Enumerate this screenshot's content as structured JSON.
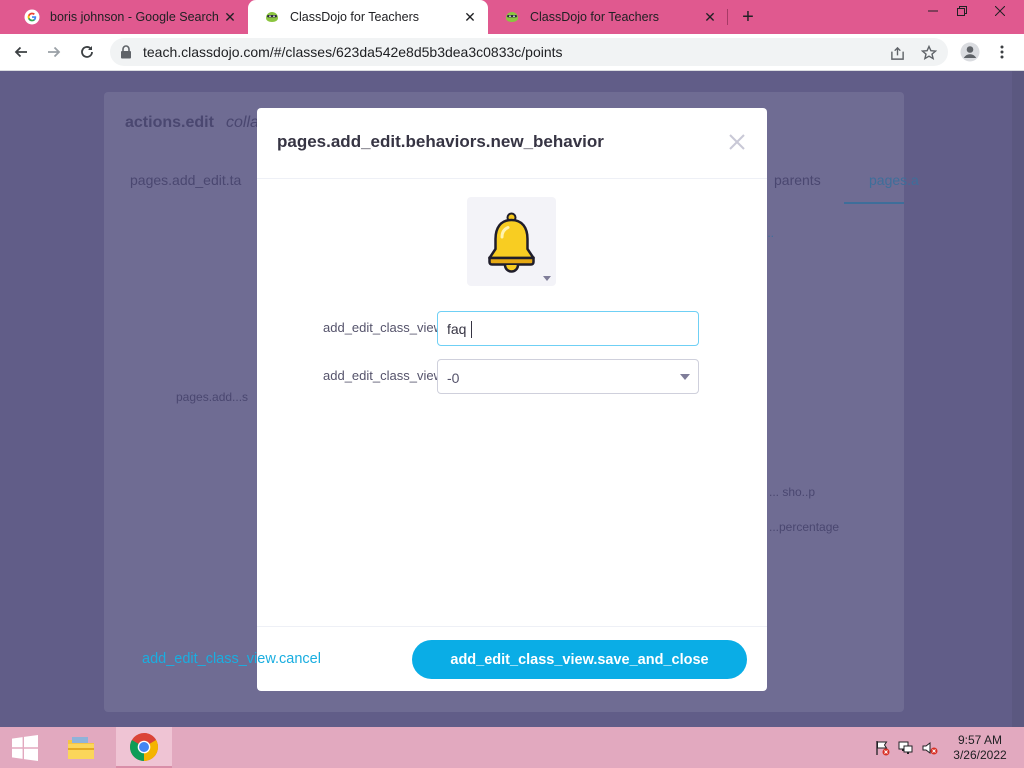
{
  "browser": {
    "tabs": [
      {
        "title": "boris johnson - Google Search",
        "favicon": "google-g-icon",
        "active": false
      },
      {
        "title": "ClassDojo for Teachers",
        "favicon": "classdojo-icon",
        "active": true
      },
      {
        "title": "ClassDojo for Teachers",
        "favicon": "classdojo-icon",
        "active": false
      }
    ],
    "url": "teach.classdojo.com/#/classes/623da542e8d5b3dea3c0833c/points"
  },
  "background": {
    "heading": "actions.edit",
    "heading_suffix": "colla",
    "tab_left": "pages.add_edit.ta",
    "tab_right": "parents",
    "tab_active": "pages.a",
    "side_text": "pages.add...s",
    "link_text": "...",
    "right_text_1": "... sho..p",
    "right_text_2": "...percentage"
  },
  "modal": {
    "title": "pages.add_edit.behaviors.new_behavior",
    "icon": "bell-icon",
    "name_label": "add_edit_class_view.name",
    "name_value": "faq",
    "points_label": "add_edit_class_view.points",
    "points_value": "-0",
    "cancel_label": "add_edit_class_view.cancel",
    "save_label": "add_edit_class_view.save_and_close"
  },
  "taskbar": {
    "time": "9:57 AM",
    "date": "3/26/2022"
  },
  "colors": {
    "tab_strip": "#e0598f",
    "accent": "#0aade6",
    "overlay": "#615d88",
    "taskbar": "#e2a9bf"
  }
}
